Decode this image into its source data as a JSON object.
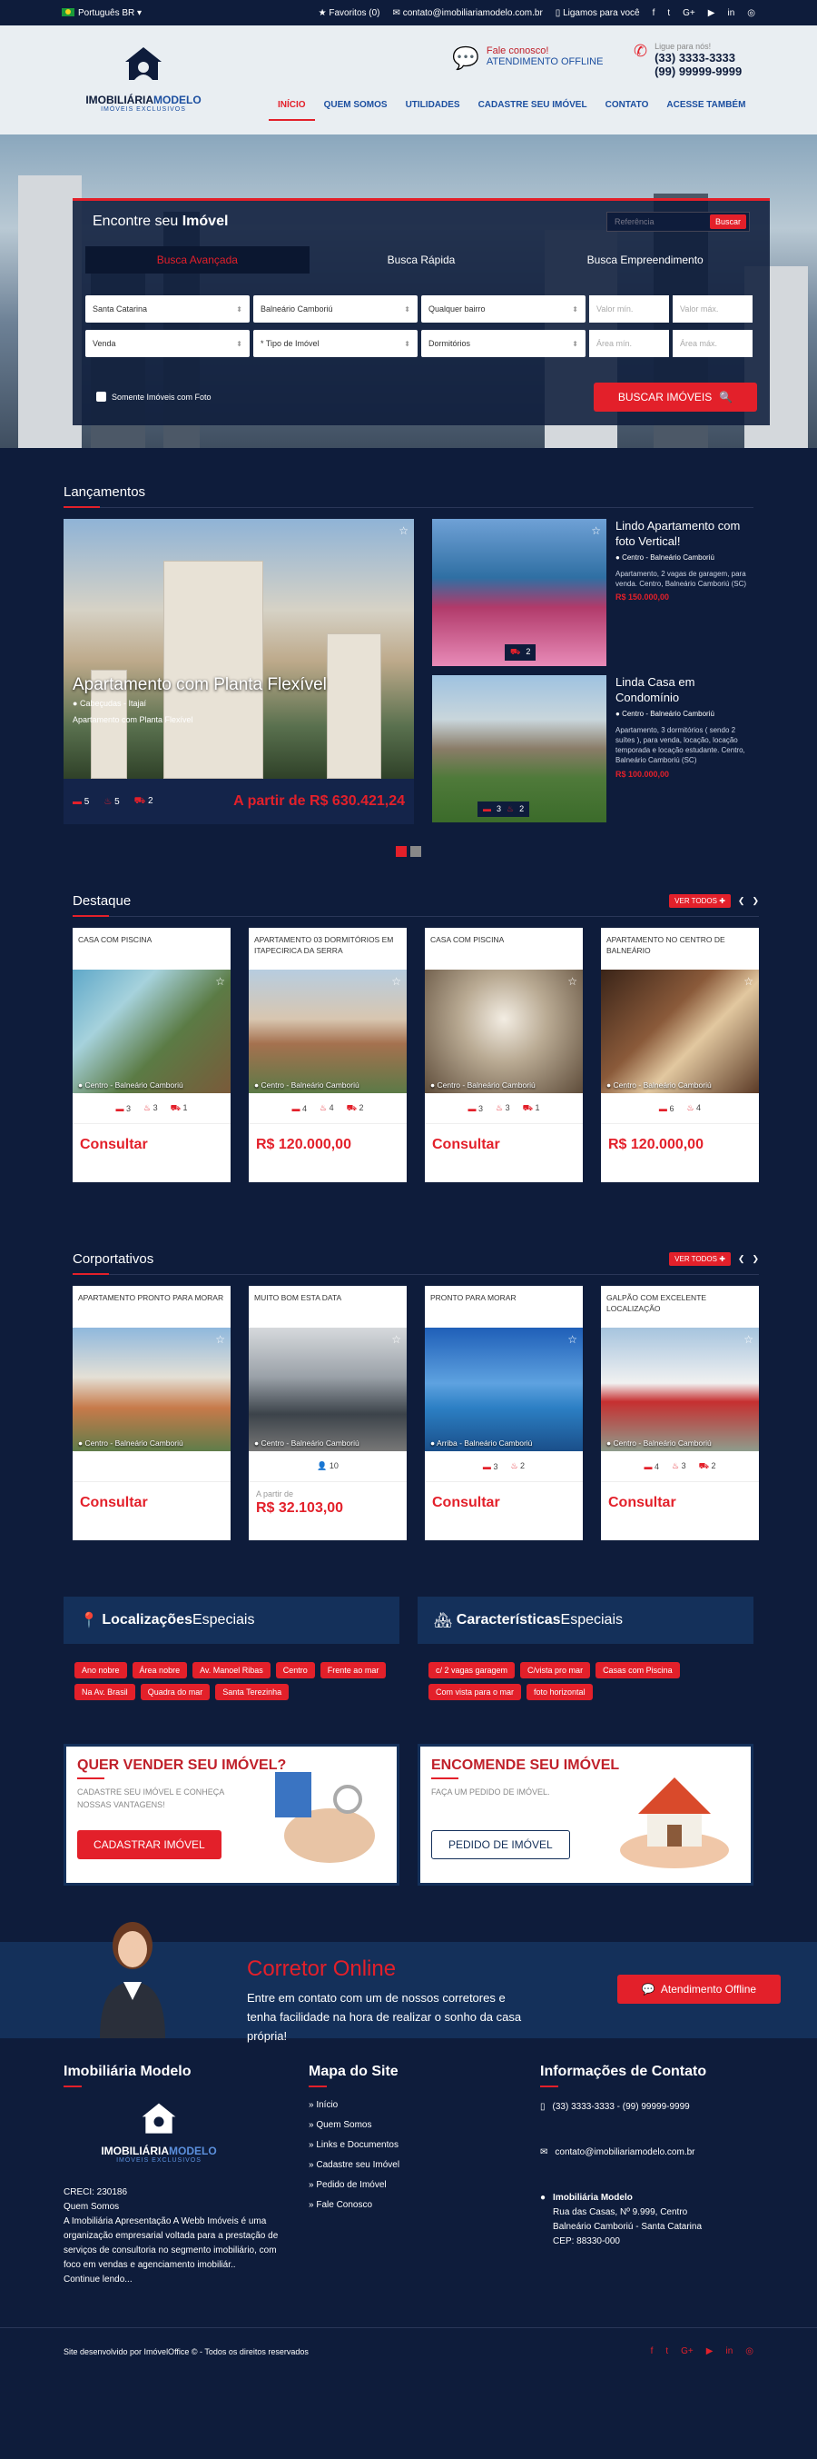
{
  "topbar": {
    "language": "Português BR",
    "favorites": "Favoritos (0)",
    "email": "contato@imobiliariamodelo.com.br",
    "callback": "Ligamos para você"
  },
  "header": {
    "logo_name_a": "IMOBILIÁRIA",
    "logo_name_b": "MODELO",
    "logo_tag": "IMÓVEIS EXCLUSIVOS",
    "fale": "Fale conosco!",
    "atendimento": "ATENDIMENTO OFFLINE",
    "ligue": "Ligue para nós!",
    "phone1": "(33) 3333-3333",
    "phone2": "(99) 99999-9999",
    "nav": [
      "INÍCIO",
      "QUEM SOMOS",
      "UTILIDADES",
      "CADASTRE SEU IMÓVEL",
      "CONTATO",
      "ACESSE TAMBÉM"
    ]
  },
  "search": {
    "title_a": "Encontre seu ",
    "title_b": "Imóvel",
    "ref_placeholder": "Referência",
    "ref_button": "Buscar",
    "tabs": [
      "Busca Avançada",
      "Busca Rápida",
      "Busca Empreendimento"
    ],
    "state": "Santa Catarina",
    "city": "Balneário Camboriú",
    "bairro": "Qualquer bairro",
    "valor_min": "Valor mín.",
    "valor_max": "Valor máx.",
    "negocio": "Venda",
    "tipo": "* Tipo de Imóvel",
    "dormitorios": "Dormitórios",
    "area_min": "Área mín.",
    "area_max": "Área máx.",
    "only_photo": "Somente Imóveis com Foto",
    "submit": "BUSCAR IMÓVEIS"
  },
  "lancamentos": {
    "title": "Lançamentos",
    "featured": {
      "title": "Apartamento com Planta Flexível",
      "location": "Cabeçudas - Itajaí",
      "subtitle": "Apartamento com Planta Flexível",
      "beds": "5",
      "baths": "5",
      "cars": "2",
      "price": "A partir de R$ 630.421,24"
    },
    "items": [
      {
        "title": "Lindo Apartamento com foto Vertical!",
        "location": "Centro - Balneário Camboriú",
        "desc": "Apartamento, 2 vagas de garagem, para venda. Centro, Balneário Camboriú (SC)",
        "price": "R$ 150.000,00",
        "badge": "2"
      },
      {
        "title": "Linda Casa em Condomínio",
        "location": "Centro - Balneário Camboriú",
        "desc": "Apartamento, 3 dormitórios ( sendo 2 suítes ), para venda, locação, locação temporada e locação estudante. Centro, Balneário Camboriú (SC)",
        "price": "R$ 100.000,00",
        "badge_a": "3",
        "badge_b": "2"
      }
    ]
  },
  "destaque": {
    "title": "Destaque",
    "ver_todos": "VER TODOS",
    "cards": [
      {
        "title": "CASA COM PISCINA",
        "location": "Centro - Balneário Camboriú",
        "f1": "3",
        "f2": "3",
        "f3": "1",
        "price": "Consultar"
      },
      {
        "title": "APARTAMENTO 03 DORMITÓRIOS EM ITAPECIRICA DA SERRA",
        "location": "Centro - Balneário Camboriú",
        "f1": "4",
        "f2": "4",
        "f3": "2",
        "price": "R$ 120.000,00"
      },
      {
        "title": "CASA COM PISCINA",
        "location": "Centro - Balneário Camboriú",
        "f1": "3",
        "f2": "3",
        "f3": "1",
        "price": "Consultar"
      },
      {
        "title": "APARTAMENTO NO CENTRO DE BALNEÁRIO",
        "location": "Centro - Balneário Camboriú",
        "f1": "6",
        "f2": "4",
        "price": "R$ 120.000,00"
      }
    ]
  },
  "corporativos": {
    "title": "Corportativos",
    "ver_todos": "VER TODOS",
    "cards": [
      {
        "title": "APARTAMENTO PRONTO PARA MORAR",
        "location": "Centro - Balneário Camboriú",
        "price": "Consultar"
      },
      {
        "title": "MUITO BOM ESTA DATA",
        "location": "Centro - Balneário Camboriú",
        "f1": "10",
        "apartir": "A partir de",
        "price": "R$ 32.103,00"
      },
      {
        "title": "PRONTO PARA MORAR",
        "location": "Arriba - Balneário Camboriú",
        "f1": "3",
        "f2": "2",
        "price": "Consultar"
      },
      {
        "title": "GALPÃO COM EXCELENTE LOCALIZAÇÃO",
        "location": "Centro - Balneário Camboriú",
        "f1": "4",
        "f2": "3",
        "f3": "2",
        "price": "Consultar"
      }
    ]
  },
  "especiais": {
    "loc_a": "Localizações",
    "loc_b": " Especiais",
    "car_a": "Características",
    "car_b": " Especiais",
    "locations": [
      "Ano nobre",
      "Área nobre",
      "Av. Manoel Ribas",
      "Centro",
      "Frente ao mar",
      "Na Av. Brasil",
      "Quadra do mar",
      "Santa Terezinha"
    ],
    "features": [
      "c/ 2 vagas garagem",
      "C/vista pro mar",
      "Casas com Piscina",
      "Com vista para o mar",
      "foto horizontal"
    ]
  },
  "cta": {
    "vender_title": "QUER VENDER SEU IMÓVEL?",
    "vender_desc": "CADASTRE SEU IMÓVEL E CONHEÇA NOSSAS VANTAGENS!",
    "vender_btn": "CADASTRAR IMÓVEL",
    "encomende_title": "ENCOMENDE SEU IMÓVEL",
    "encomende_desc": "FAÇA UM PEDIDO DE IMÓVEL.",
    "encomende_btn": "PEDIDO DE IMÓVEL"
  },
  "corretor": {
    "title": "Corretor Online",
    "desc": "Entre em contato com um de nossos corretores e tenha facilidade na hora de realizar o sonho da casa própria!",
    "btn": "Atendimento Offline"
  },
  "footer": {
    "col1_title": "Imobiliária Modelo",
    "creci": "CRECI: 230186",
    "quem": "Quem Somos",
    "about": "A Imobiliária Apresentação A Webb Imóveis é uma organização empresarial voltada para a prestação de serviços de consultoria no segmento imobiliário, com foco em vendas e agenciamento imobiliár..",
    "continue": "Continue lendo...",
    "col2_title": "Mapa do Site",
    "map": [
      "Início",
      "Quem Somos",
      "Links e Documentos",
      "Cadastre seu Imóvel",
      "Pedido de Imóvel",
      "Fale Conosco"
    ],
    "col3_title": "Informações de Contato",
    "phones": "(33) 3333-3333 - (99) 99999-9999",
    "email": "contato@imobiliariamodelo.com.br",
    "addr_name": "Imobiliária Modelo",
    "addr1": "Rua das Casas, Nº 9.999, Centro",
    "addr2": "Balneário Camboriú - Santa Catarina",
    "cep": "CEP: 88330-000"
  },
  "bottom": {
    "credits": "Site desenvolvido por ImóvelOffice © - Todos os direitos reservados"
  },
  "colors": {
    "navy": "#0e1c3b",
    "red": "#e3202a",
    "blue": "#14305a"
  }
}
